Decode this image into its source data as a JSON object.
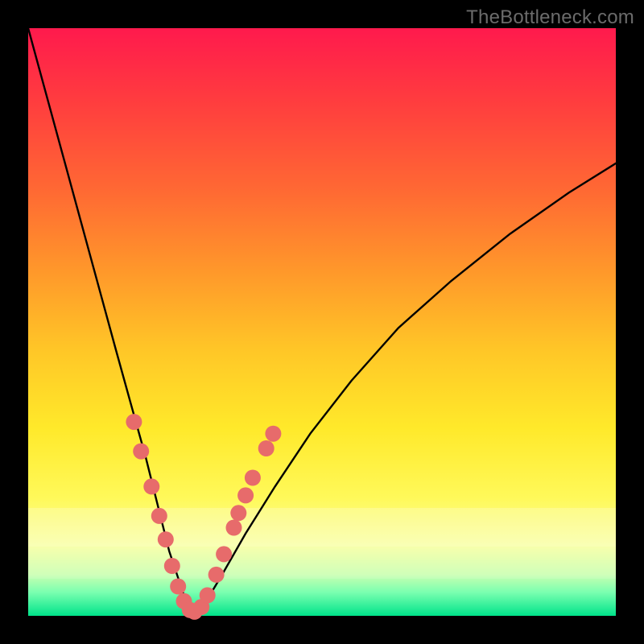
{
  "watermark": "TheBottleneck.com",
  "colors": {
    "background": "#000000",
    "dot": "#e76b6b",
    "curve": "#000000"
  },
  "chart_data": {
    "type": "line",
    "title": "",
    "xlabel": "",
    "ylabel": "",
    "xlim": [
      0,
      100
    ],
    "ylim": [
      0,
      100
    ],
    "grid": false,
    "legend": false,
    "note": "V-shaped bottleneck curve on red→green gradient. Values are approximate pixel-plot percentages read from the figure (x increases rightward, y increases upward; 0% at bottom, 100% at top).",
    "series": [
      {
        "name": "curve",
        "x": [
          0,
          3,
          6,
          9,
          12,
          15,
          17.5,
          20,
          22,
          24,
          26,
          27,
          28,
          30,
          33,
          37,
          42,
          48,
          55,
          63,
          72,
          82,
          92,
          100
        ],
        "y": [
          100,
          89,
          78,
          67,
          56,
          45,
          36,
          27,
          19,
          11,
          5,
          2,
          0.5,
          2,
          7,
          14,
          22,
          31,
          40,
          49,
          57,
          65,
          72,
          77
        ]
      }
    ],
    "dots": [
      {
        "x": 18.0,
        "y": 33.0
      },
      {
        "x": 19.2,
        "y": 28.0
      },
      {
        "x": 21.0,
        "y": 22.0
      },
      {
        "x": 22.3,
        "y": 17.0
      },
      {
        "x": 23.4,
        "y": 13.0
      },
      {
        "x": 24.5,
        "y": 8.5
      },
      {
        "x": 25.5,
        "y": 5.0
      },
      {
        "x": 26.5,
        "y": 2.5
      },
      {
        "x": 27.5,
        "y": 1.0
      },
      {
        "x": 28.3,
        "y": 0.7
      },
      {
        "x": 29.5,
        "y": 1.5
      },
      {
        "x": 30.5,
        "y": 3.5
      },
      {
        "x": 32.0,
        "y": 7.0
      },
      {
        "x": 33.3,
        "y": 10.5
      },
      {
        "x": 35.0,
        "y": 15.0
      },
      {
        "x": 35.8,
        "y": 17.5
      },
      {
        "x": 37.0,
        "y": 20.5
      },
      {
        "x": 38.2,
        "y": 23.5
      },
      {
        "x": 40.5,
        "y": 28.5
      },
      {
        "x": 41.7,
        "y": 31.0
      }
    ]
  }
}
